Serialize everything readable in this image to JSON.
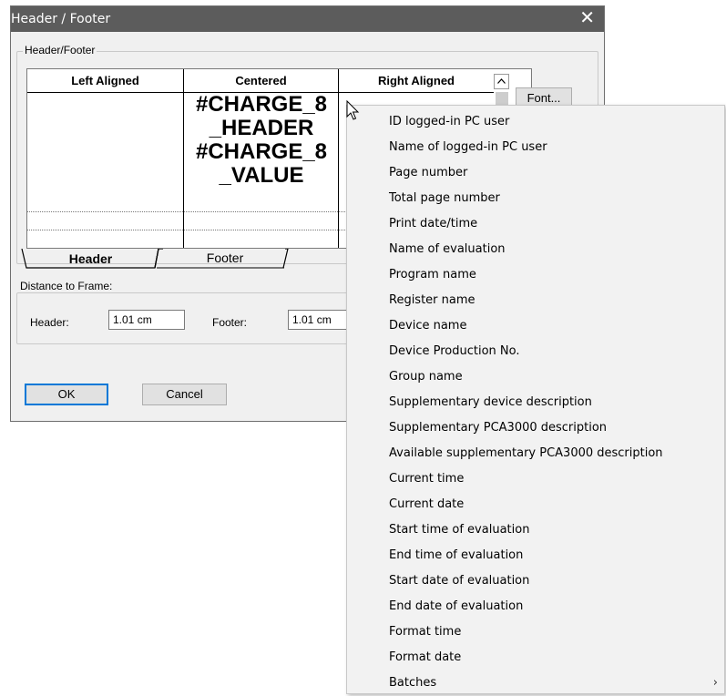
{
  "window": {
    "title": "Header / Footer",
    "close_glyph": "✕"
  },
  "group_header_footer": {
    "label": "Header/Footer"
  },
  "grid": {
    "columns": [
      "Left Aligned",
      "Centered",
      "Right Aligned"
    ],
    "centered_cell_lines": [
      "#CHARGE_8",
      "_HEADER",
      "#CHARGE_8",
      "_VALUE"
    ]
  },
  "tabs": [
    "Header",
    "Footer"
  ],
  "buttons": {
    "font": "Font...",
    "ok": "OK",
    "cancel": "Cancel"
  },
  "distance": {
    "label": "Distance to Frame:",
    "header_label": "Header:",
    "header_value": "1.01 cm",
    "footer_label": "Footer:",
    "footer_value": "1.01 cm"
  },
  "context_menu": {
    "items": [
      "ID logged-in PC user",
      "Name of logged-in PC user",
      "Page number",
      "Total page number",
      "Print date/time",
      "Name of evaluation",
      "Program name",
      "Register name",
      "Device name",
      "Device Production No.",
      "Group name",
      "Supplementary device description",
      "Supplementary PCA3000 description",
      "Available supplementary PCA3000 description",
      "Current time",
      "Current date",
      "Start time of evaluation",
      "End time of evaluation",
      "Start date of evaluation",
      "End date of evaluation",
      "Format time",
      "Format date",
      "Batches"
    ],
    "submenu_arrow": "›"
  },
  "colors": {
    "titlebar": "#5c5c5c",
    "dialog_bg": "#f0f0f0",
    "ok_border": "#0078d7",
    "menu_bg": "#f2f2f2"
  }
}
